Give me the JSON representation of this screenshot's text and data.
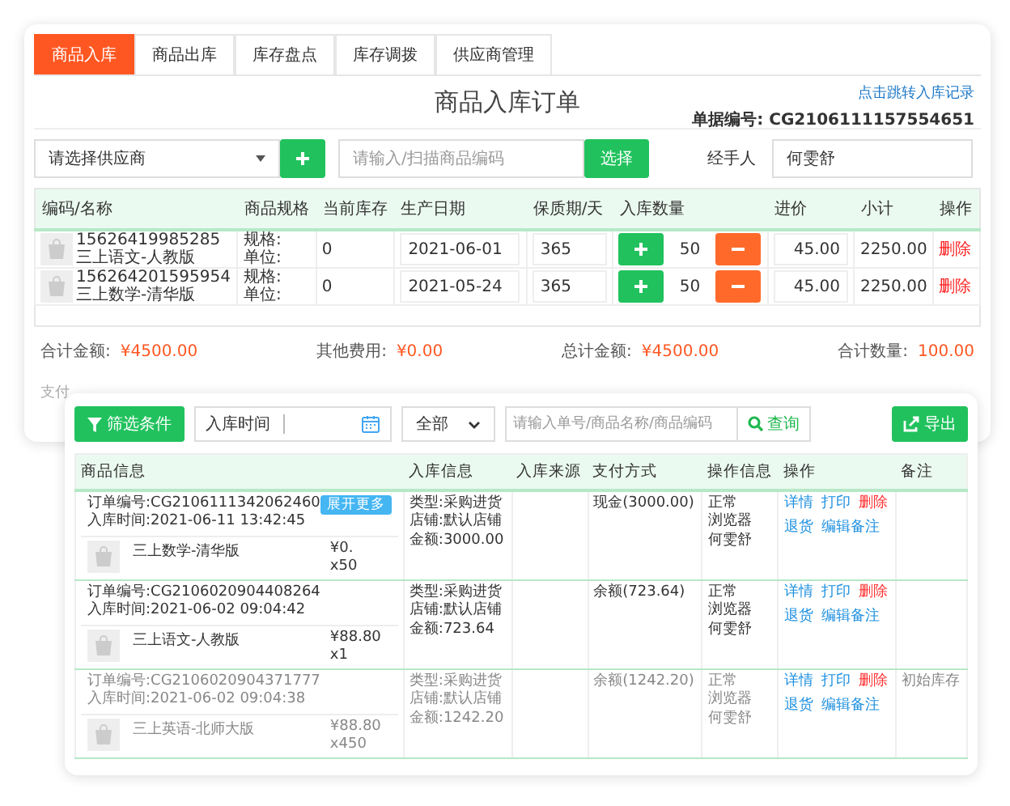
{
  "tabs": [
    {
      "label": "商品入库",
      "selected": true
    },
    {
      "label": "商品出库",
      "selected": false
    },
    {
      "label": "库存盘点",
      "selected": false
    },
    {
      "label": "库存调拨",
      "selected": false
    },
    {
      "label": "供应商管理",
      "selected": false
    }
  ],
  "order_form": {
    "title": "商品入库订单",
    "record_link": "点击跳转入库记录",
    "order_no_label": "单据编号:",
    "order_no": "CG2106111157554651",
    "supplier": "请选择供应商",
    "code_placeholder": "请输入/扫描商品编码",
    "select_button": "选择",
    "handler_label": "经手人",
    "handler": "何雯舒",
    "columns": [
      "编码/名称",
      "商品规格",
      "当前库存",
      "生产日期",
      "保质期/天",
      "入库数量",
      "进价",
      "小计",
      "操作"
    ],
    "rows": [
      {
        "code": "15626419985285",
        "name": "三上语文-人教版",
        "spec": "规格:",
        "unit": "单位:",
        "stock": "0",
        "date": "2021-06-01",
        "shelf_life": "365",
        "qty": "50",
        "price": "45.00",
        "subtotal": "2250.00",
        "action": "删除"
      },
      {
        "code": "15626420159595​4",
        "name": "三上数学-清华版",
        "spec": "规格:",
        "unit": "单位:",
        "stock": "0",
        "date": "2021-05-24",
        "shelf_life": "365",
        "qty": "50",
        "price": "45.00",
        "subtotal": "2250.00",
        "action": "删除"
      }
    ],
    "totals": [
      {
        "label": "合计金额:",
        "value": "¥4500.00"
      },
      {
        "label": "其他费用:",
        "value": "¥0.00"
      },
      {
        "label": "总计金额:",
        "value": "¥4500.00"
      },
      {
        "label": "合计数量:",
        "value": "100.00"
      }
    ],
    "payment_label": "支付"
  },
  "records_panel": {
    "filter_button": "筛选条件",
    "date_label": "入库时间",
    "status": "全部",
    "search_placeholder": "请输入单号/商品名称/商品编码",
    "search_button": "查询",
    "export_button": "导出",
    "columns": [
      "商品信息",
      "入库信息",
      "入库来源",
      "支付方式",
      "操作信息",
      "操作",
      "备注"
    ],
    "records": [
      {
        "order_no": "订单编号:CG2106111342062460",
        "time": "入库时间:2021-06-11 13:42:45",
        "badge": "展开更多",
        "item_name": "三上数学-清华版",
        "item_price": "¥0.",
        "item_qty": "x50",
        "info": [
          "类型:采购进货",
          "店铺:默认店铺",
          "金额:3000.00"
        ],
        "payment": "现金(3000.00)",
        "op_info": [
          "正常",
          "浏览器",
          "何雯舒"
        ],
        "actions": [
          {
            "label": "详情",
            "kind": "link"
          },
          {
            "label": "打印",
            "kind": "link"
          },
          {
            "label": "删除",
            "kind": "danger"
          },
          {
            "label": "退货",
            "kind": "link"
          },
          {
            "label": "编辑备注",
            "kind": "link"
          }
        ]
      },
      {
        "order_no": "订单编号:CG2106020904408264",
        "time": "入库时间:2021-06-02 09:04:42",
        "item_name": "三上语文-人教版",
        "item_price": "¥88.80",
        "item_qty": "x1",
        "info": [
          "类型:采购进货",
          "店铺:默认店铺",
          "金额:723.64"
        ],
        "payment": "余额(723.64)",
        "op_info": [
          "正常",
          "浏览器",
          "何雯舒"
        ],
        "actions": [
          {
            "label": "详情",
            "kind": "link"
          },
          {
            "label": "打印",
            "kind": "link"
          },
          {
            "label": "删除",
            "kind": "danger"
          },
          {
            "label": "退货",
            "kind": "link"
          },
          {
            "label": "编辑备注",
            "kind": "link"
          }
        ]
      },
      {
        "order_no": "订单编号:CG2106020904371777",
        "time": "入库时间:2021-06-02 09:04:38",
        "item_name": "三上英语-北师大版",
        "item_price": "¥88.80",
        "item_qty": "x450",
        "info": [
          "类型:采购进货",
          "店铺:默认店铺",
          "金额:1242.20"
        ],
        "payment": "余额(1242.20)",
        "op_info": [
          "正常",
          "浏览器",
          "何雯舒"
        ],
        "actions": [
          {
            "label": "详情",
            "kind": "link"
          },
          {
            "label": "打印",
            "kind": "link"
          },
          {
            "label": "删除",
            "kind": "danger"
          },
          {
            "label": "退货",
            "kind": "link"
          },
          {
            "label": "编辑备注",
            "kind": "link"
          }
        ],
        "note": "初始库存"
      }
    ]
  }
}
